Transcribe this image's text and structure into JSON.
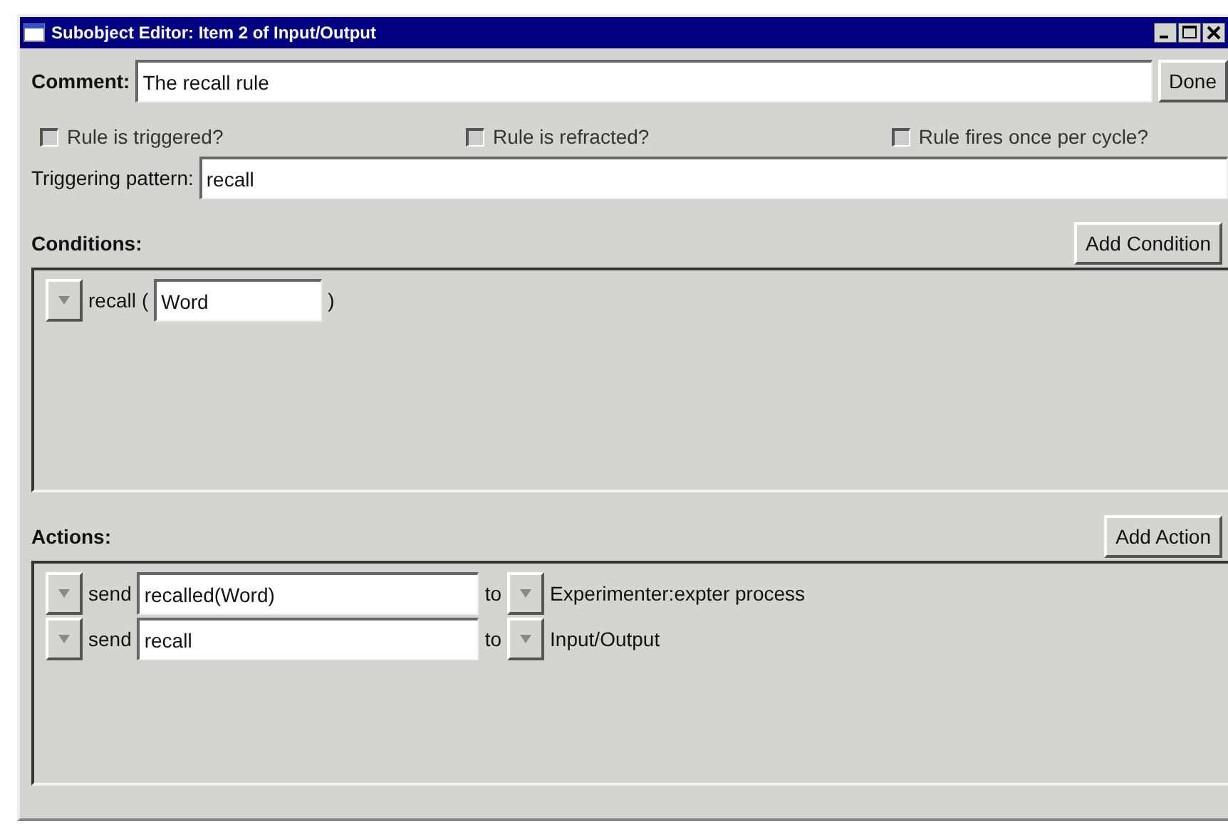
{
  "window": {
    "title": "Subobject Editor: Item 2 of Input/Output"
  },
  "comment": {
    "label": "Comment:",
    "value": "The recall rule"
  },
  "done_button": "Done",
  "options": [
    {
      "label": "Rule is triggered?",
      "checked": false
    },
    {
      "label": "Rule is refracted?",
      "checked": false
    },
    {
      "label": "Rule fires once per cycle?",
      "checked": false
    }
  ],
  "triggering_pattern": {
    "label": "Triggering pattern:",
    "value": "recall"
  },
  "conditions": {
    "heading": "Conditions:",
    "add_button": "Add Condition",
    "rows": [
      {
        "name": "recall",
        "open_paren": "(",
        "argument": "Word",
        "close_paren": ")"
      }
    ]
  },
  "actions": {
    "heading": "Actions:",
    "add_button": "Add Action",
    "rows": [
      {
        "verb": "send",
        "message": "recalled(Word)",
        "preposition": "to",
        "target": "Experimenter:expter process"
      },
      {
        "verb": "send",
        "message": "recall",
        "preposition": "to",
        "target": "Input/Output"
      }
    ]
  }
}
